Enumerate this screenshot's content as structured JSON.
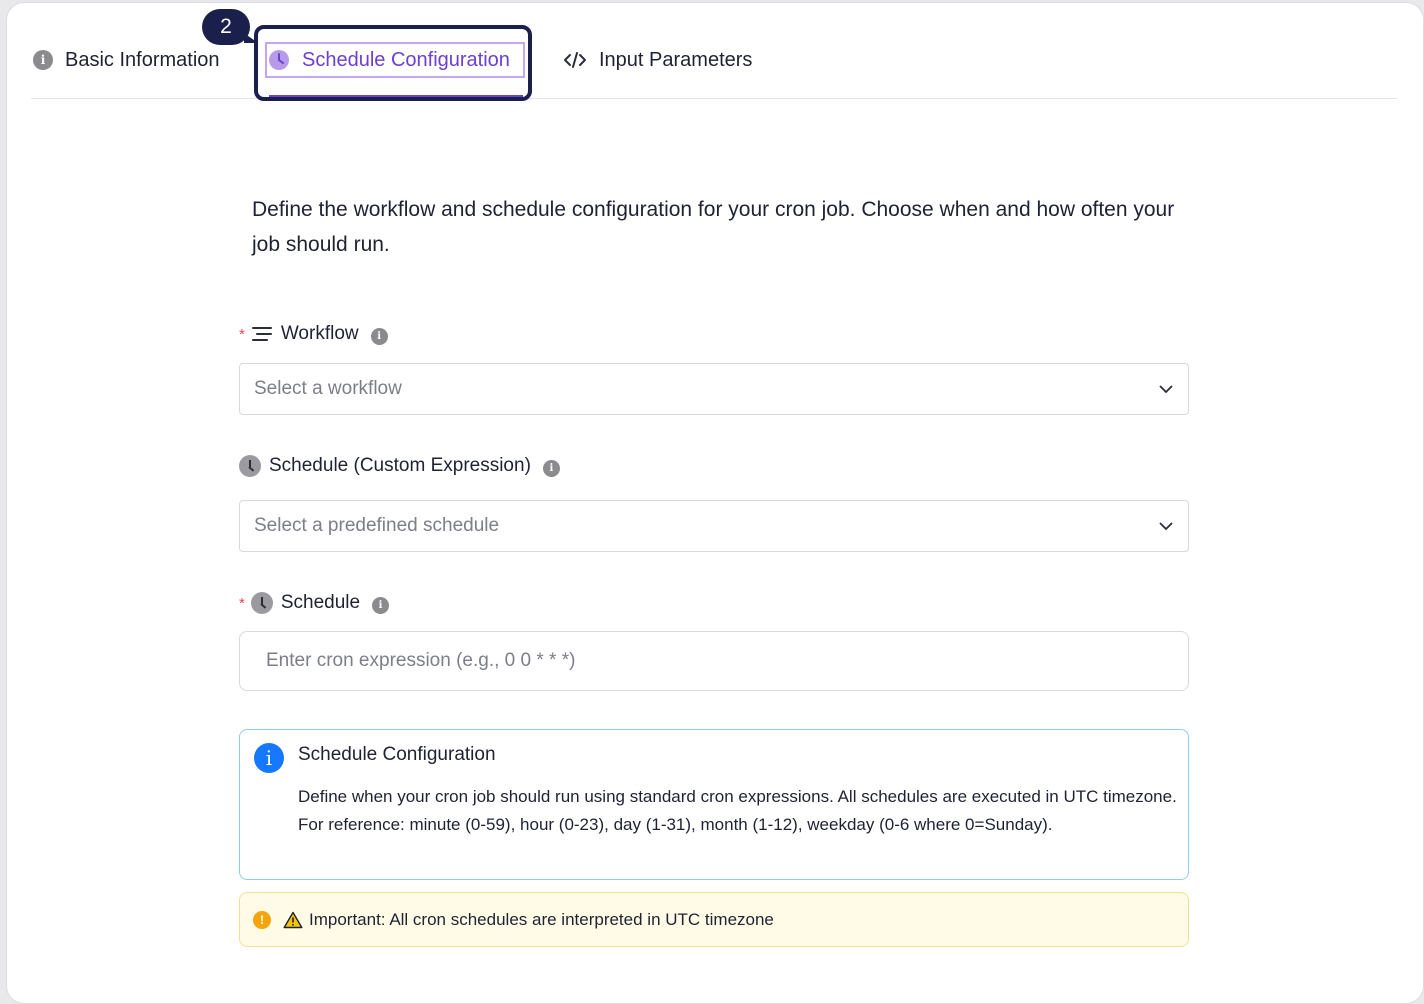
{
  "tabs": {
    "step_badge": "2",
    "items": [
      {
        "label": "Basic Information",
        "icon": "info-icon"
      },
      {
        "label": "Schedule Configuration",
        "icon": "clock-icon",
        "active": true
      },
      {
        "label": "Input Parameters",
        "icon": "code-icon"
      }
    ]
  },
  "intro": "Define the workflow and schedule configuration for your cron job. Choose when and how often your job should run.",
  "workflow": {
    "required_mark": "*",
    "label": "Workflow",
    "placeholder": "Select a workflow"
  },
  "custom_schedule": {
    "label": "Schedule (Custom Expression)",
    "placeholder": "Select a predefined schedule"
  },
  "schedule": {
    "required_mark": "*",
    "label": "Schedule",
    "placeholder": "Enter cron expression (e.g., 0 0 * * *)"
  },
  "info_box": {
    "title": "Schedule Configuration",
    "description": "Define when your cron job should run using standard cron expressions. All schedules are executed in UTC timezone. For reference: minute (0-59), hour (0-23), day (1-31), month (1-12), weekday (0-6 where 0=Sunday)."
  },
  "warning": {
    "text": "Important: All cron schedules are interpreted in UTC timezone"
  },
  "colors": {
    "accent": "#6b3fd4",
    "badge": "#1a1f4b",
    "info_blue": "#1677ff",
    "warning": "#f5a50a",
    "required": "#e5484d"
  }
}
